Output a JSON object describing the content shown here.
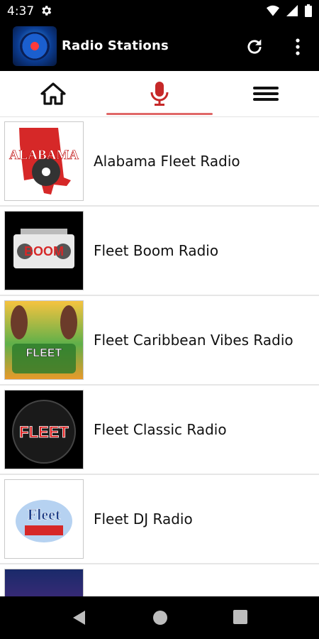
{
  "status_bar": {
    "time": "4:37"
  },
  "app_bar": {
    "title": "Radio Stations"
  },
  "stations": [
    {
      "name": "Alabama Fleet Radio",
      "logo_text": "ALABAMA"
    },
    {
      "name": "Fleet Boom Radio",
      "logo_text": "BOOM"
    },
    {
      "name": "Fleet Caribbean Vibes Radio",
      "logo_text": "FLEET"
    },
    {
      "name": "Fleet Classic Radio",
      "logo_text": "FLEET"
    },
    {
      "name": "Fleet DJ Radio",
      "logo_text": "Fleet"
    },
    {
      "name": "",
      "logo_text": ""
    }
  ],
  "colors": {
    "accent": "#c62828",
    "indicator": "#e06767"
  }
}
